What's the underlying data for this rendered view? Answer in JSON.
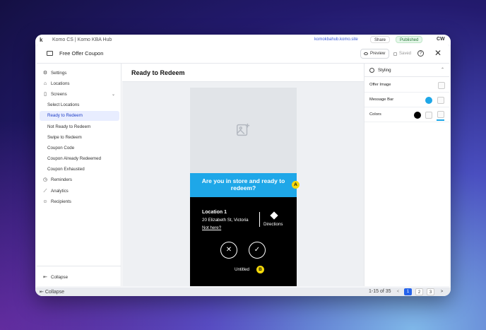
{
  "app": {
    "logo": "k",
    "breadcrumb": "Komo CS  |  Komo KBA Hub",
    "link": "komokbahub.komo.site",
    "share_label": "Share",
    "published_label": "Published",
    "avatar_initials": "CW",
    "collapse_label": "Collapse",
    "pagination": {
      "range_text": "1-15 of 35",
      "prev": "<",
      "pages": [
        "1",
        "2",
        "3"
      ],
      "current_page": "1",
      "next": ">"
    }
  },
  "modal": {
    "title": "Free Offer Coupon",
    "preview_label": "Preview",
    "saved_label": "Saved",
    "help_glyph": "?",
    "close_glyph": "✕"
  },
  "sidebar": {
    "items": [
      {
        "label": "Settings",
        "icon": "gear-icon"
      },
      {
        "label": "Locations",
        "icon": "location-icon"
      },
      {
        "label": "Screens",
        "icon": "phone-icon"
      },
      {
        "label": "Select Locations"
      },
      {
        "label": "Ready to Redeem"
      },
      {
        "label": "Not Ready to Redeem"
      },
      {
        "label": "Swipe to Redeem"
      },
      {
        "label": "Coupon Code"
      },
      {
        "label": "Coupon Already Redeemed"
      },
      {
        "label": "Coupon Exhausted"
      },
      {
        "label": "Reminders",
        "icon": "clock-icon"
      },
      {
        "label": "Analytics",
        "icon": "chart-icon"
      },
      {
        "label": "Recipients",
        "icon": "users-icon"
      }
    ],
    "selected": "Ready to Redeem",
    "collapse_label": "Collapse"
  },
  "main": {
    "title": "Ready to Redeem",
    "phone": {
      "message": "Are you in store and ready to redeem?",
      "location_name": "Location 1",
      "location_address": "20 Elizabeth St, Victoria",
      "location_link": "Not here?",
      "directions_label": "Directions",
      "decline_glyph": "✕",
      "accept_glyph": "✓",
      "caption": "Untitled"
    },
    "markers": [
      "A",
      "B"
    ]
  },
  "styling_panel": {
    "title": "Styling",
    "rows": [
      {
        "label": "Offer Image"
      },
      {
        "label": "Message Bar",
        "color": "#1ea7e8"
      },
      {
        "label": "Colors",
        "color": "#000000",
        "accent": "#1ea7e8"
      }
    ]
  }
}
